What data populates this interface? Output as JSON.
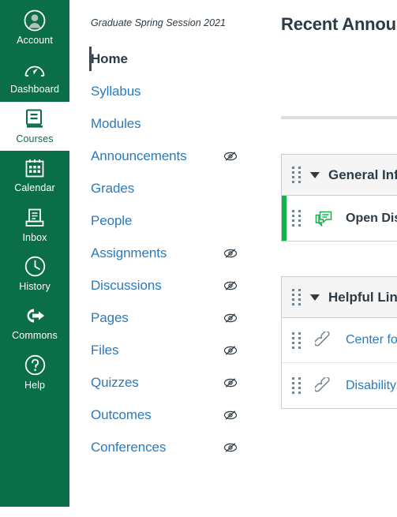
{
  "global_nav": {
    "items": [
      {
        "label": "Account",
        "icon": "account-avatar-icon",
        "active": false
      },
      {
        "label": "Dashboard",
        "icon": "dashboard-gauge-icon",
        "active": false
      },
      {
        "label": "Courses",
        "icon": "courses-book-icon",
        "active": true
      },
      {
        "label": "Calendar",
        "icon": "calendar-icon",
        "active": false
      },
      {
        "label": "Inbox",
        "icon": "inbox-tray-icon",
        "active": false
      },
      {
        "label": "History",
        "icon": "history-clock-icon",
        "active": false
      },
      {
        "label": "Commons",
        "icon": "commons-arrow-icon",
        "active": false
      },
      {
        "label": "Help",
        "icon": "help-question-icon",
        "active": false
      }
    ]
  },
  "course_nav": {
    "term": "Graduate Spring Session 2021",
    "items": [
      {
        "label": "Home",
        "active": true,
        "hidden_indicator": false
      },
      {
        "label": "Syllabus",
        "active": false,
        "hidden_indicator": false
      },
      {
        "label": "Modules",
        "active": false,
        "hidden_indicator": false
      },
      {
        "label": "Announcements",
        "active": false,
        "hidden_indicator": true
      },
      {
        "label": "Grades",
        "active": false,
        "hidden_indicator": false
      },
      {
        "label": "People",
        "active": false,
        "hidden_indicator": false
      },
      {
        "label": "Assignments",
        "active": false,
        "hidden_indicator": true
      },
      {
        "label": "Discussions",
        "active": false,
        "hidden_indicator": true
      },
      {
        "label": "Pages",
        "active": false,
        "hidden_indicator": true
      },
      {
        "label": "Files",
        "active": false,
        "hidden_indicator": true
      },
      {
        "label": "Quizzes",
        "active": false,
        "hidden_indicator": true
      },
      {
        "label": "Outcomes",
        "active": false,
        "hidden_indicator": true
      },
      {
        "label": "Conferences",
        "active": false,
        "hidden_indicator": true
      }
    ]
  },
  "main": {
    "page_title": "Recent Announcements",
    "modules": [
      {
        "title": "General Information",
        "collapse_icon": "chevron-down-icon",
        "drag_icon": "drag-handle-icon",
        "items": [
          {
            "title": "Open Discussion Forum",
            "icon": "discussion-icon",
            "published": true,
            "style": "bold"
          }
        ]
      },
      {
        "title": "Helpful Links",
        "collapse_icon": "chevron-down-icon",
        "drag_icon": "drag-handle-icon",
        "items": [
          {
            "title": "Center for Teaching",
            "icon": "external-link-icon",
            "published": false,
            "style": "link"
          },
          {
            "title": "Disability Resources",
            "icon": "external-link-icon",
            "published": false,
            "style": "link"
          }
        ]
      }
    ]
  },
  "colors": {
    "global_nav_green": "#0a6e48",
    "link_blue": "#2b7abc",
    "text_dark": "#2d3b45",
    "published_green": "#0fb54a",
    "module_header_gray": "#f5f5f5",
    "border_gray": "#c7cdd1"
  }
}
